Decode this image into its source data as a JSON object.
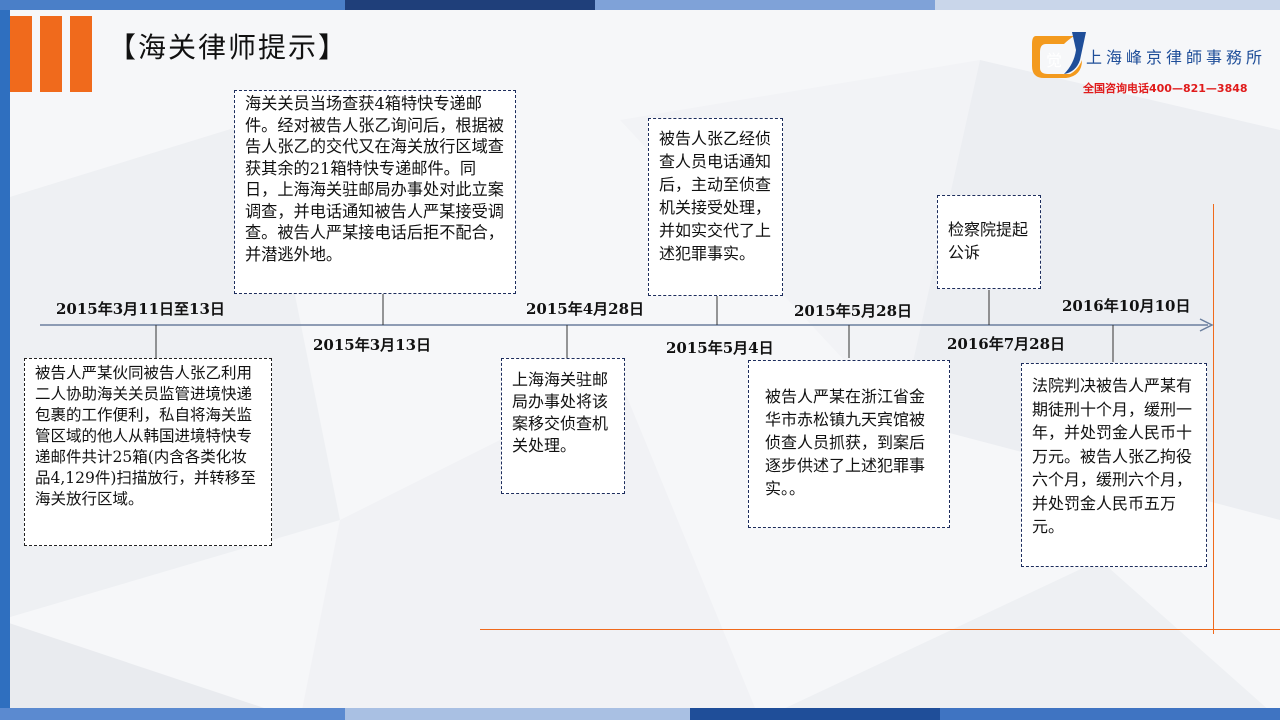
{
  "header": {
    "title": "【海关律师提示】"
  },
  "brand": {
    "logo_text": "觉",
    "firm_name": "上海峰京律師事務所",
    "hotline": "全国咨询电话400—821—3848",
    "colors": {
      "orange": "#f06a1c",
      "blue": "#1f4e99",
      "red": "#e01b1b"
    }
  },
  "timeline": {
    "dates": [
      "2015年3月11日至13日",
      "2015年3月13日",
      "2015年4月28日",
      "2015年5月4日",
      "2015年5月28日",
      "2016年7月28日",
      "2016年10月10日"
    ],
    "events": [
      "被告人严某伙同被告人张乙利用二人协助海关关员监管进境快递包裹的工作便利，私自将海关监管区域的他人从韩国进境特快专递邮件共计25箱(内含各类化妆品4,129件)扫描放行，并转移至海关放行区域。",
      "海关关员当场查获4箱特快专递邮件。经对被告人张乙询问后，根据被告人张乙的交代又在海关放行区域查获其余的21箱特快专递邮件。同日，上海海关驻邮局办事处对此立案调查，并电话通知被告人严某接受调查。被告人严某接电话后拒不配合，并潜逃外地。",
      "上海海关驻邮局办事处将该案移交侦查机关处理。",
      "被告人张乙经侦查人员电话通知后，主动至侦查机关接受处理，并如实交代了上述犯罪事实。",
      "被告人严某在浙江省金华市赤松镇九天宾馆被侦查人员抓获，到案后逐步供述了上述犯罪事实。。",
      "检察院提起公诉",
      "法院判决被告人严某有期徒刑十个月，缓刑一年，并处罚金人民币十万元。被告人张乙拘役六个月，缓刑六个月，并处罚金人民币五万元。"
    ]
  }
}
